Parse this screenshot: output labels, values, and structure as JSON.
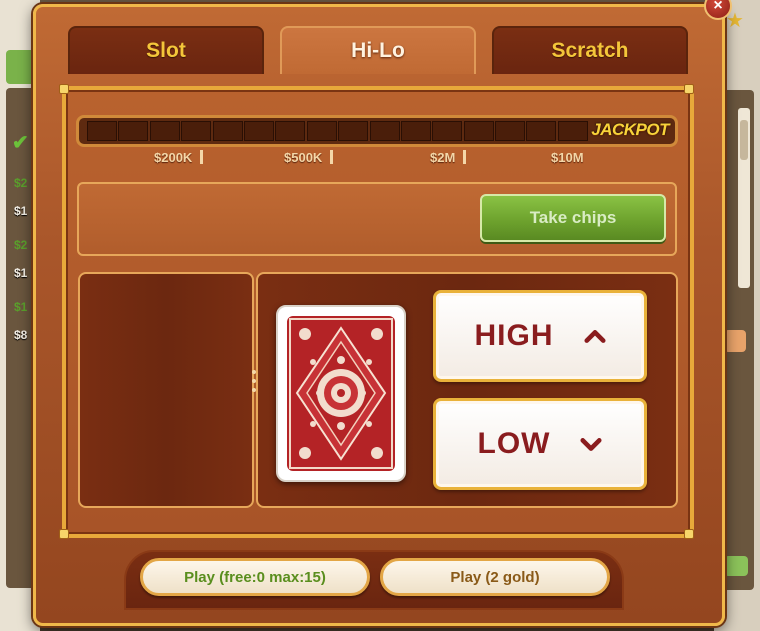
{
  "tabs": [
    {
      "label": "Slot",
      "active": false
    },
    {
      "label": "Hi-Lo",
      "active": true
    },
    {
      "label": "Scratch",
      "active": false
    }
  ],
  "jackpot": {
    "label": "JACKPOT",
    "segments": 16,
    "milestones": [
      "$200K",
      "$500K",
      "$2M",
      "$10M"
    ]
  },
  "take_chips_label": "Take chips",
  "buttons": {
    "high_label": "HIGH",
    "low_label": "LOW"
  },
  "play": {
    "free_label": "Play (free:0 max:15)",
    "gold_label": "Play (2 gold)"
  },
  "close_label": "×",
  "background": {
    "left_rows": [
      {
        "text": "$2",
        "color": "g"
      },
      {
        "text": "$1",
        "color": "w"
      },
      {
        "text": "$2",
        "color": "g"
      },
      {
        "text": "$1",
        "color": "w"
      },
      {
        "text": "$1",
        "color": "g"
      },
      {
        "text": "$8",
        "color": "w"
      }
    ],
    "bottom_text": "Top"
  },
  "colors": {
    "accent_gold": "#f4c63a",
    "card_red": "#b42326",
    "green_button": "#6ea32e",
    "dark_red_text": "#8a1c1e"
  },
  "icons": {
    "high": "chevron-up-icon",
    "low": "chevron-down-icon",
    "close": "close-icon"
  }
}
